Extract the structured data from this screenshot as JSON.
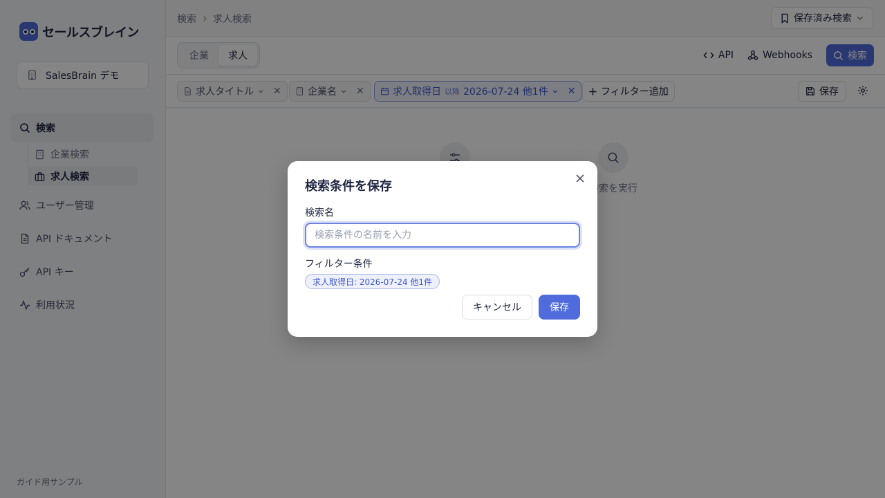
{
  "app": {
    "logo_text": "セールスブレイン",
    "footer_note": "ガイド用サンプル"
  },
  "workspace": {
    "label": "SalesBrain デモ"
  },
  "sidebar": {
    "items": [
      {
        "label": "検索",
        "icon": "search-icon"
      },
      {
        "label": "ユーザー管理",
        "icon": "users-icon"
      },
      {
        "label": "API ドキュメント",
        "icon": "document-icon"
      },
      {
        "label": "API キー",
        "icon": "key-icon"
      },
      {
        "label": "利用状況",
        "icon": "activity-icon"
      }
    ],
    "sub_items": [
      {
        "label": "企業検索",
        "icon": "building-icon"
      },
      {
        "label": "求人検索",
        "icon": "briefcase-icon",
        "active": true
      }
    ]
  },
  "header": {
    "breadcrumb": [
      "検索",
      "求人検索"
    ],
    "saved_searches_label": "保存済み検索"
  },
  "toolbar": {
    "tabs": [
      {
        "label": "企業"
      },
      {
        "label": "求人",
        "active": true
      }
    ],
    "api_label": "API",
    "webhooks_label": "Webhooks",
    "search_label": "検索"
  },
  "filters": {
    "chips": [
      {
        "label": "求人タイトル"
      },
      {
        "label": "企業名"
      },
      {
        "label": "求人取得日",
        "operator": "以降",
        "value": "2026-07-24 他1件",
        "active": true
      }
    ],
    "add_label": "フィルター追加",
    "save_label": "保存"
  },
  "empty_state": {
    "run_label": "検索を実行"
  },
  "modal": {
    "title": "検索条件を保存",
    "name_label": "検索名",
    "name_placeholder": "検索条件の名前を入力",
    "name_value": "",
    "conditions_label": "フィルター条件",
    "condition_tag": "求人取得日: 2026-07-24 他1件",
    "cancel_label": "キャンセル",
    "save_label": "保存"
  },
  "colors": {
    "accent": "#4f6bdc",
    "overlay": "rgba(0,0,0,0.48)"
  }
}
